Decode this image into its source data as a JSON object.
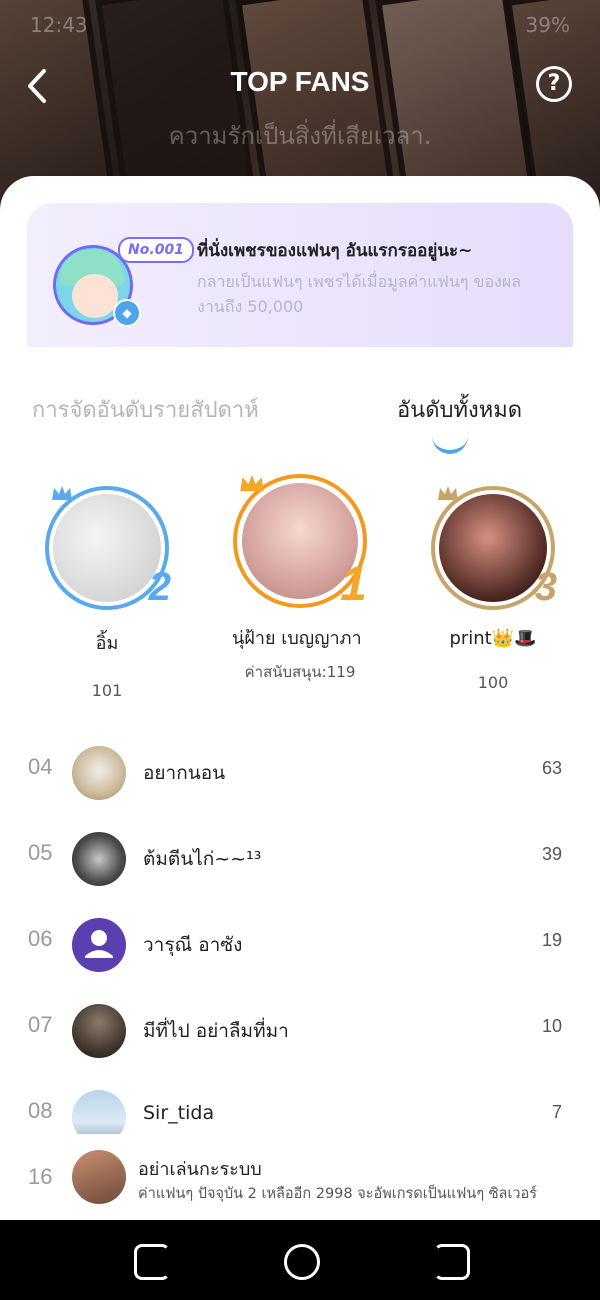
{
  "status_bar": {
    "time": "12:43",
    "battery": "39%"
  },
  "header": {
    "back_icon": "chevron-left-icon",
    "title": "TOP FANS",
    "help_icon": "question-circle-icon",
    "tagline": "ความรักเป็นสิ่งที่เสียเวลา."
  },
  "banner": {
    "badge": "No.001",
    "headline": "ที่นั่งเพชรของแฟนๆ อันแรกรออยู่นะ~",
    "description": "กลายเป็นแฟนๆ เพชรได้เมื่อมูลค่าแฟนๆ ของผลงานถึง 50,000",
    "gem_icon": "diamond-icon"
  },
  "tabs": {
    "weekly": "การจัดอันดับรายสัปดาห์",
    "all": "อันดับทั้งหมด",
    "active": "all"
  },
  "podium": {
    "first": {
      "rank": "1",
      "name": "นุ่ฝ้าย เบญญาภา",
      "value_label": "ค่าสนับสนุน:119",
      "ring_color": "#f39a1e"
    },
    "second": {
      "rank": "2",
      "name": "อิ้ม",
      "value": "101",
      "ring_color": "#5aa8ee"
    },
    "third": {
      "rank": "3",
      "name": "print👑🎩",
      "value": "100",
      "ring_color": "#c8a46a"
    }
  },
  "ranking": [
    {
      "rank": "04",
      "name": "อยากนอน",
      "value": "63"
    },
    {
      "rank": "05",
      "name": "ต้มตีนไก่~~¹³",
      "value": "39"
    },
    {
      "rank": "06",
      "name": "วารุณี อาซัง",
      "value": "19"
    },
    {
      "rank": "07",
      "name": "มีที่ไป อย่าลืมที่มา",
      "value": "10"
    },
    {
      "rank": "08",
      "name": "Sir_tida",
      "value": "7"
    }
  ],
  "my_rank": {
    "rank": "16",
    "name": "อย่าเล่นกะระบบ",
    "description": "ค่าแฟนๆ ปัจจุบัน 2 เหลืออีก 2998 จะอัพเกรดเป็นแฟนๆ ซิลเวอร์"
  },
  "nav_bar": {
    "recent_icon": "recent-apps-icon",
    "home_icon": "home-icon",
    "back_icon": "back-icon"
  }
}
